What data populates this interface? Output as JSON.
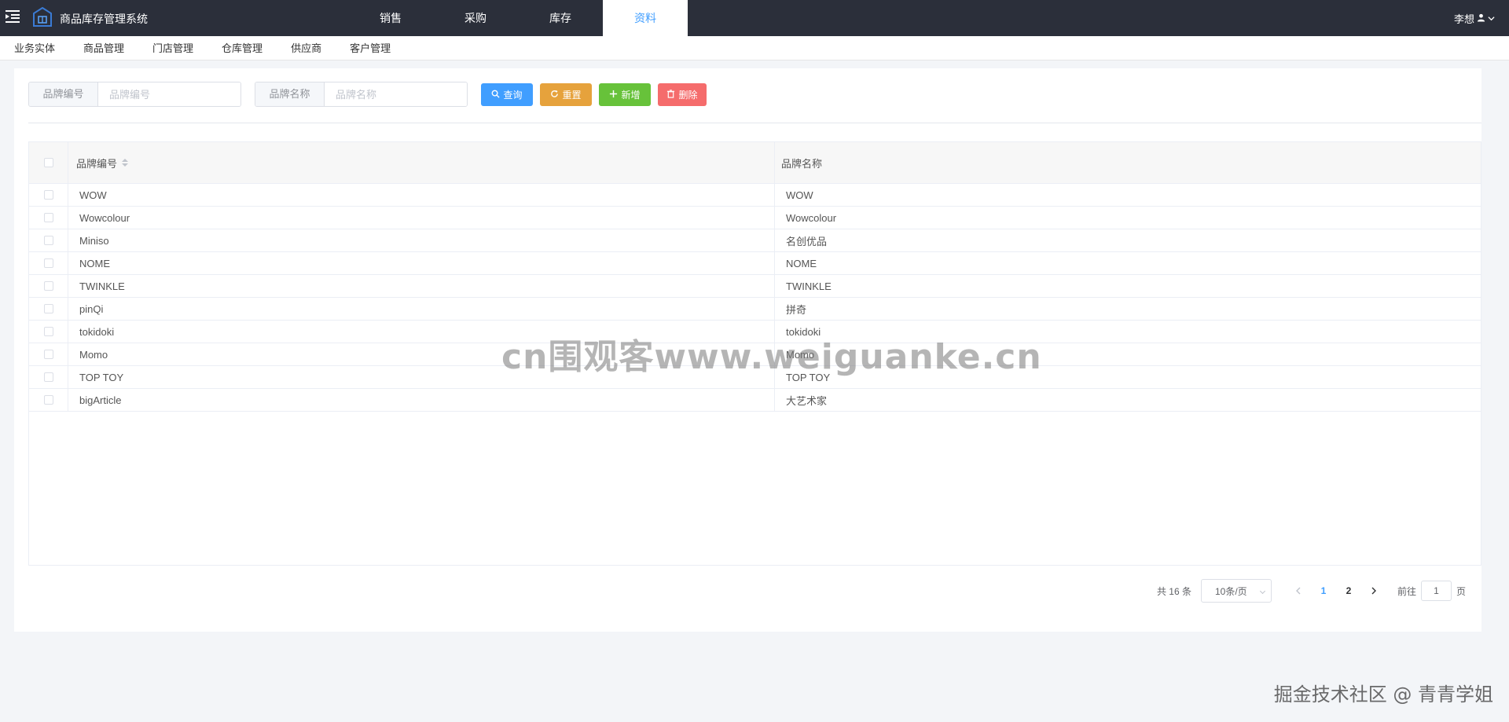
{
  "header": {
    "app_title": "商品库存管理系统",
    "nav": [
      {
        "label": "销售",
        "active": false
      },
      {
        "label": "采购",
        "active": false
      },
      {
        "label": "库存",
        "active": false
      },
      {
        "label": "资料",
        "active": true
      }
    ],
    "user_name": "李想"
  },
  "subnav": [
    "业务实体",
    "商品管理",
    "门店管理",
    "仓库管理",
    "供应商",
    "客户管理"
  ],
  "search": {
    "code_label": "品牌编号",
    "code_placeholder": "品牌编号",
    "name_label": "品牌名称",
    "name_placeholder": "品牌名称"
  },
  "buttons": {
    "search": "查询",
    "reset": "重置",
    "add": "新增",
    "delete": "删除"
  },
  "table": {
    "columns": [
      "品牌编号",
      "品牌名称"
    ],
    "rows": [
      [
        "WOW",
        "WOW"
      ],
      [
        "Wowcolour",
        "Wowcolour"
      ],
      [
        "Miniso",
        "名创优品"
      ],
      [
        "NOME",
        "NOME"
      ],
      [
        "TWINKLE",
        "TWINKLE"
      ],
      [
        "pinQi",
        "拼奇"
      ],
      [
        "tokidoki",
        "tokidoki"
      ],
      [
        "Momo",
        "Momo"
      ],
      [
        "TOP TOY",
        "TOP TOY"
      ],
      [
        "bigArticle",
        "大艺术家"
      ]
    ]
  },
  "pagination": {
    "total": "共 16 条",
    "page_size": "10条/页",
    "pages": [
      "1",
      "2"
    ],
    "current": "1",
    "goto_prefix": "前往",
    "goto_value": "1",
    "goto_suffix": "页"
  },
  "watermarks": {
    "center": "cn围观客www.weiguanke.cn",
    "bottom": "掘金技术社区 @ 青青学姐"
  },
  "colors": {
    "primary": "#409eff",
    "warning": "#e6a23c",
    "success": "#67c23a",
    "danger": "#f56c6c",
    "header_bg": "#2b2f3a"
  }
}
